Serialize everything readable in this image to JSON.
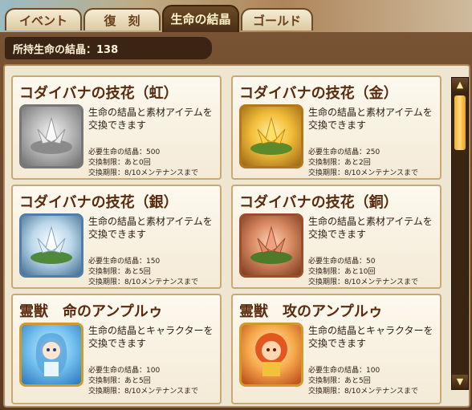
{
  "tabs": [
    {
      "label": "イベント"
    },
    {
      "label": "復　刻"
    },
    {
      "label": "生命の結晶"
    },
    {
      "label": "ゴールド"
    }
  ],
  "holder_label": "所持生命の結晶：138",
  "cards": [
    {
      "title": "コダイバナの技花（虹）",
      "desc": "生命の結晶と素材アイテムを交換できます",
      "cost": "必要生命の結晶：500",
      "limit": "交換制限：あと0回",
      "period": "交換期限：8/10メンテナンスまで",
      "icon": "gray-lotus-icon",
      "color": "#8a8a8a"
    },
    {
      "title": "コダイバナの技花（金）",
      "desc": "生命の結晶と素材アイテムを交換できます",
      "cost": "必要生命の結晶：250",
      "limit": "交換制限：あと2回",
      "period": "交換期限：8/10メンテナンスまで",
      "icon": "gold-lotus-icon",
      "color": "#e0a52a"
    },
    {
      "title": "コダイバナの技花（銀）",
      "desc": "生命の結晶と素材アイテムを交換できます",
      "cost": "必要生命の結晶：150",
      "limit": "交換制限：あと5回",
      "period": "交換期限：8/10メンテナンスまで",
      "icon": "silver-lotus-icon",
      "color": "#7fb0d0"
    },
    {
      "title": "コダイバナの技花（銅）",
      "desc": "生命の結晶と素材アイテムを交換できます",
      "cost": "必要生命の結晶：50",
      "limit": "交換制限：あと10回",
      "period": "交換期限：8/10メンテナンスまで",
      "icon": "bronze-lotus-icon",
      "color": "#c0704a"
    },
    {
      "title": "霊獣　命のアンプルゥ",
      "desc": "生命の結晶とキャラクターを交換できます",
      "cost": "必要生命の結晶：100",
      "limit": "交換制限：あと5回",
      "period": "交換期限：8/10メンテナンスまで",
      "icon": "blue-spirit-beast-icon",
      "color": "#5aa7e0"
    },
    {
      "title": "霊獣　攻のアンプルゥ",
      "desc": "生命の結晶とキャラクターを交換できます",
      "cost": "必要生命の結晶：100",
      "limit": "交換制限：あと5回",
      "period": "交換期限：8/10メンテナンスまで",
      "icon": "red-spirit-beast-icon",
      "color": "#e46a2a"
    }
  ],
  "scroll": {
    "up": "▲",
    "down": "▼",
    "position": 0.0
  }
}
